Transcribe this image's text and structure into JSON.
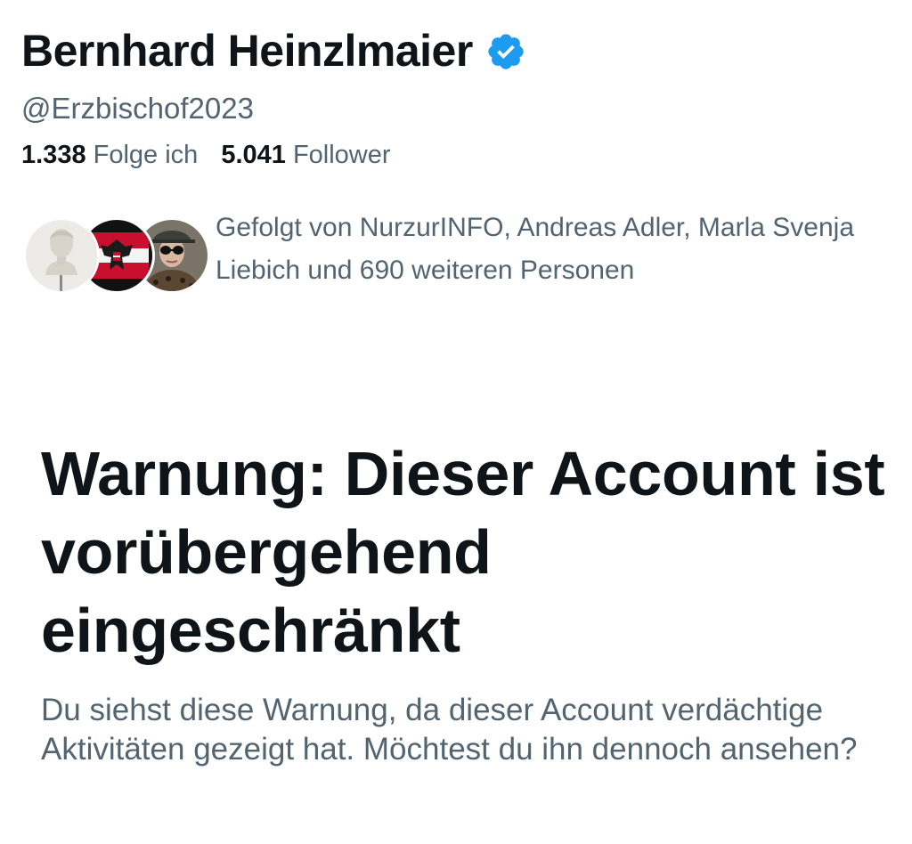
{
  "profile": {
    "display_name": "Bernhard Heinzlmaier",
    "handle": "@Erzbischof2023",
    "verified_icon": "verified-badge-icon",
    "following_count": "1.338",
    "following_label": "Folge ich",
    "followers_count": "5.041",
    "followers_label": "Follower"
  },
  "followed_by": {
    "text": "Gefolgt von NurzurINFO, Andreas Adler, Marla Svenja Liebich und 690 weiteren Personen",
    "avatars": [
      "bust-statue-avatar",
      "austrian-eagle-flag-avatar",
      "sunglasses-person-avatar"
    ]
  },
  "warning": {
    "title": "Warnung: Dieser Account ist vorübergehend eingeschränkt",
    "text": "Du siehst diese Warnung, da dieser Account verdächtige Aktivitäten gezeigt hat. Möchtest du ihn dennoch ansehen?"
  },
  "colors": {
    "primary_text": "#0f1419",
    "secondary_text": "#536471",
    "verified_blue": "#1d9bf0"
  }
}
